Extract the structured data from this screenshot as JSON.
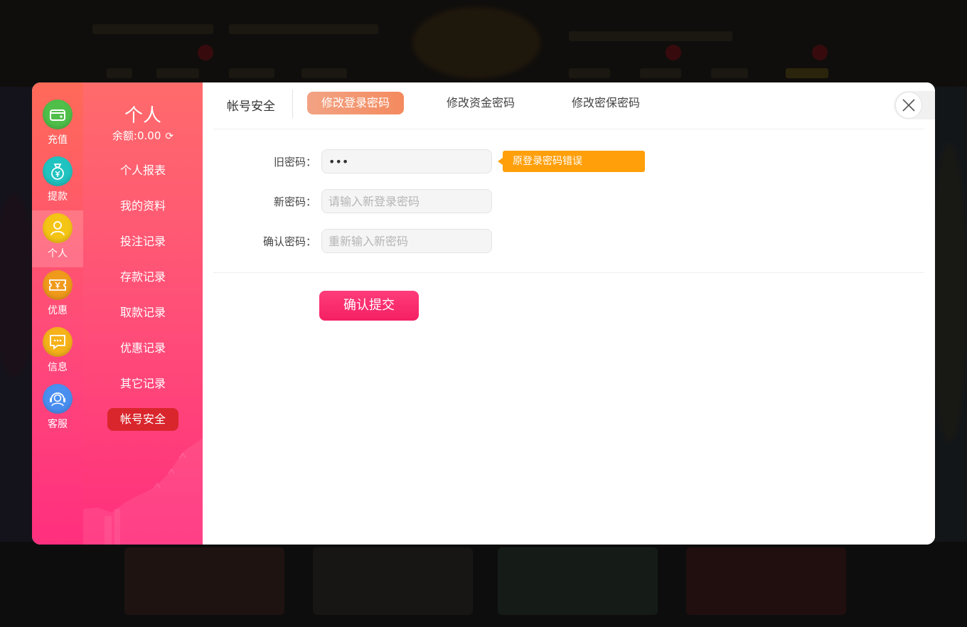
{
  "rail": {
    "items": [
      {
        "label": "充值",
        "icon": "wallet-icon",
        "color": "#4fbf4a"
      },
      {
        "label": "提款",
        "icon": "money-bag-icon",
        "color": "#20c3c0"
      },
      {
        "label": "个人",
        "icon": "user-icon",
        "color": "#f5c516",
        "active": true
      },
      {
        "label": "优惠",
        "icon": "coupon-icon",
        "color": "#f09a1c"
      },
      {
        "label": "信息",
        "icon": "message-icon",
        "color": "#f5b21a"
      },
      {
        "label": "客服",
        "icon": "headset-icon",
        "color": "#4a8ff0"
      }
    ]
  },
  "menu": {
    "title": "个人",
    "balance": "余额:0.00",
    "items": [
      {
        "label": "个人报表"
      },
      {
        "label": "我的资料"
      },
      {
        "label": "投注记录"
      },
      {
        "label": "存款记录"
      },
      {
        "label": "取款记录"
      },
      {
        "label": "优惠记录"
      },
      {
        "label": "其它记录"
      },
      {
        "label": "帐号安全",
        "active": true
      }
    ]
  },
  "tabs": {
    "section": "帐号安全",
    "items": [
      {
        "label": "修改登录密码",
        "active": true
      },
      {
        "label": "修改资金密码"
      },
      {
        "label": "修改密保密码"
      }
    ]
  },
  "form": {
    "old_password": {
      "label": "旧密码：",
      "value": "•••"
    },
    "new_password": {
      "label": "新密码：",
      "placeholder": "请输入新登录密码"
    },
    "confirm_password": {
      "label": "确认密码：",
      "placeholder": "重新输入新密码"
    },
    "error_tip": "原登录密码错误",
    "submit": "确认提交"
  },
  "colors": {
    "accent_gradient_start": "#ff6b6b",
    "accent_gradient_end": "#ff2f7d",
    "active_menu": "#d9262c",
    "active_tab": "#f48a5e",
    "error_tip": "#ff9f0a",
    "submit": "#f41f64"
  }
}
